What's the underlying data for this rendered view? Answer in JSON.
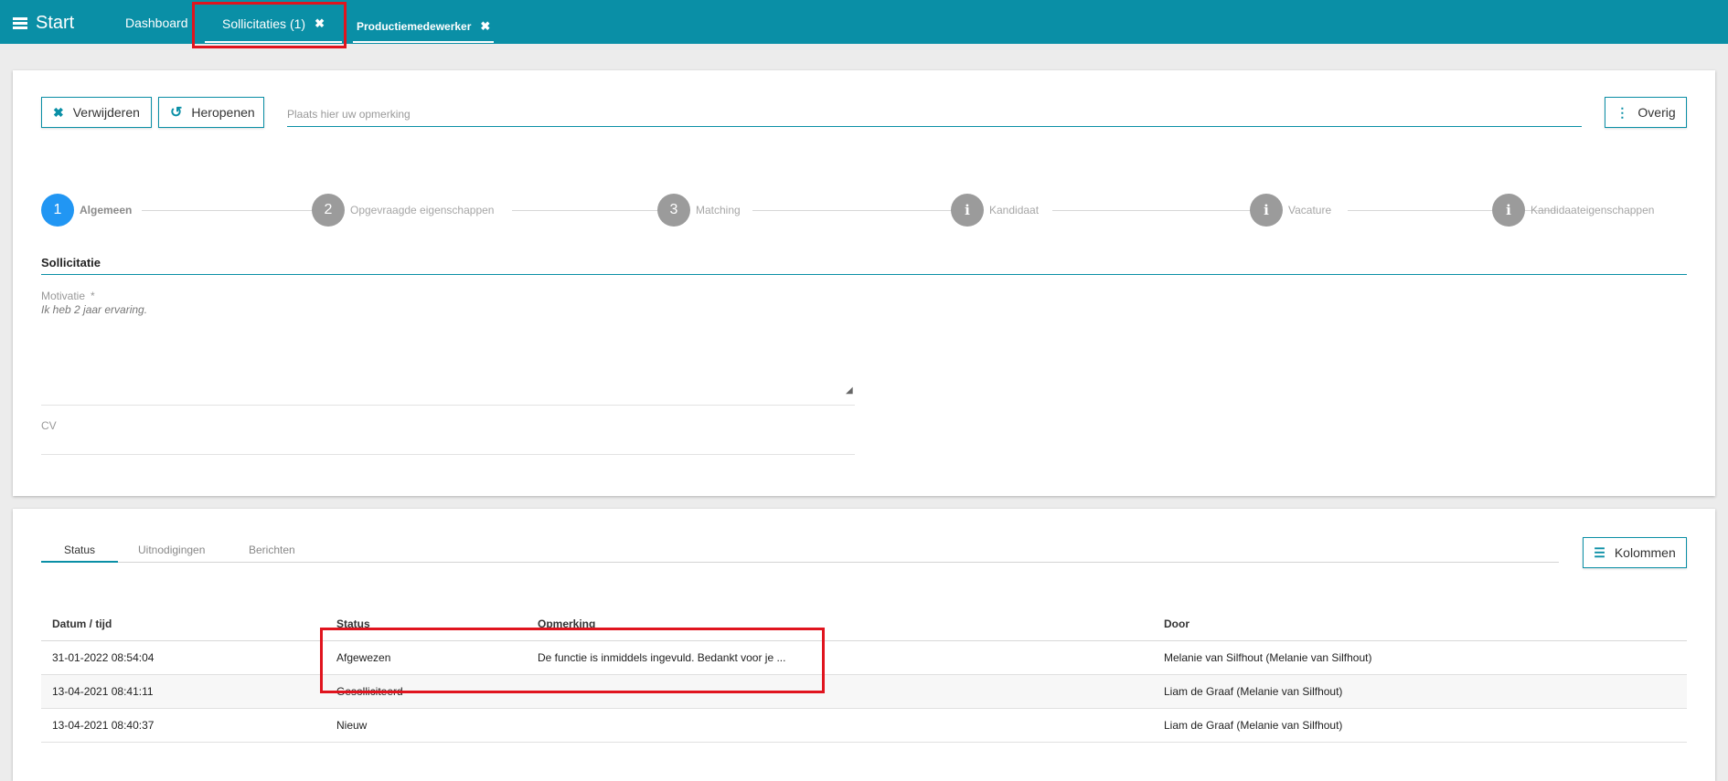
{
  "topbar": {
    "start_label": "Start",
    "tabs": [
      {
        "label": "Dashboard"
      },
      {
        "label": "Sollicitaties (1)",
        "close": "✖"
      },
      {
        "label": "Productiemedewerker",
        "close": "✖"
      }
    ]
  },
  "toolbar": {
    "delete_label": "Verwijderen",
    "reopen_label": "Heropenen",
    "remark_placeholder": "Plaats hier uw opmerking",
    "overig_label": "Overig"
  },
  "stepper": {
    "steps": [
      {
        "number": "1",
        "label": "Algemeen",
        "active": true
      },
      {
        "number": "2",
        "label": "Opgevraagde eigenschappen"
      },
      {
        "number": "3",
        "label": "Matching"
      },
      {
        "number": "i",
        "label": "Kandidaat"
      },
      {
        "number": "i",
        "label": "Vacature"
      },
      {
        "number": "i",
        "label": "Kandidaateigenschappen"
      }
    ]
  },
  "form": {
    "section_title": "Sollicitatie",
    "motivation_label": "Motivatie",
    "motivation_required": "*",
    "motivation_value": "Ik heb 2 jaar ervaring.",
    "cv_label": "CV"
  },
  "history": {
    "tabs": [
      "Status",
      "Uitnodigingen",
      "Berichten"
    ],
    "columns_button": "Kolommen",
    "headers": [
      "Datum / tijd",
      "Status",
      "Opmerking",
      "Door"
    ],
    "rows": [
      {
        "datetime": "31-01-2022 08:54:04",
        "status": "Afgewezen",
        "remark": "De functie is inmiddels ingevuld. Bedankt voor je ...",
        "by": "Melanie van Silfhout (Melanie van Silfhout)"
      },
      {
        "datetime": "13-04-2021 08:41:11",
        "status": "Gesolliciteerd",
        "remark": "",
        "by": "Liam de Graaf (Melanie van Silfhout)"
      },
      {
        "datetime": "13-04-2021 08:40:37",
        "status": "Nieuw",
        "remark": "",
        "by": "Liam de Graaf (Melanie van Silfhout)"
      }
    ]
  },
  "colors": {
    "brand": "#0a8fa6",
    "active_step": "#2196f3",
    "highlight": "#e0141e"
  }
}
